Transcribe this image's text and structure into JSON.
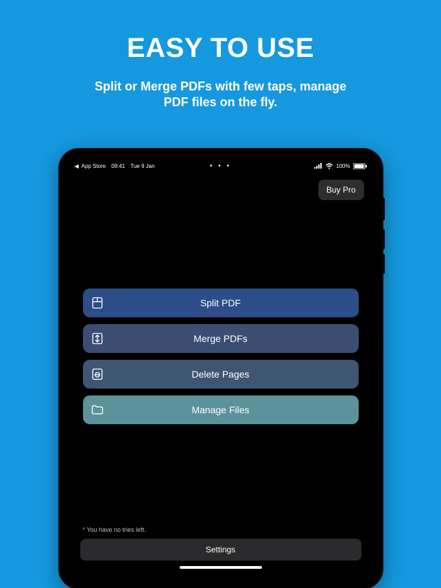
{
  "hero": {
    "title": "EASY TO USE",
    "subtitle_line1": "Split or Merge PDFs with few taps, manage",
    "subtitle_line2": "PDF files on the fly."
  },
  "statusbar": {
    "back_label": "App Store",
    "time": "09:41",
    "date": "Tue 9 Jan",
    "battery_pct": "100%",
    "ellipsis": "• • •"
  },
  "topbar": {
    "buypro_label": "Buy Pro"
  },
  "actions": {
    "split": {
      "label": "Split PDF"
    },
    "merge": {
      "label": "Merge PDFs"
    },
    "delete": {
      "label": "Delete Pages"
    },
    "manage": {
      "label": "Manage Files"
    }
  },
  "footer": {
    "tries_text": "* You have no tries left.",
    "settings_label": "Settings"
  },
  "colors": {
    "background": "#1598de",
    "btn_split": "#2c4d87",
    "btn_merge": "#3d4d72",
    "btn_delete": "#3f5672",
    "btn_manage": "#5b929b"
  }
}
